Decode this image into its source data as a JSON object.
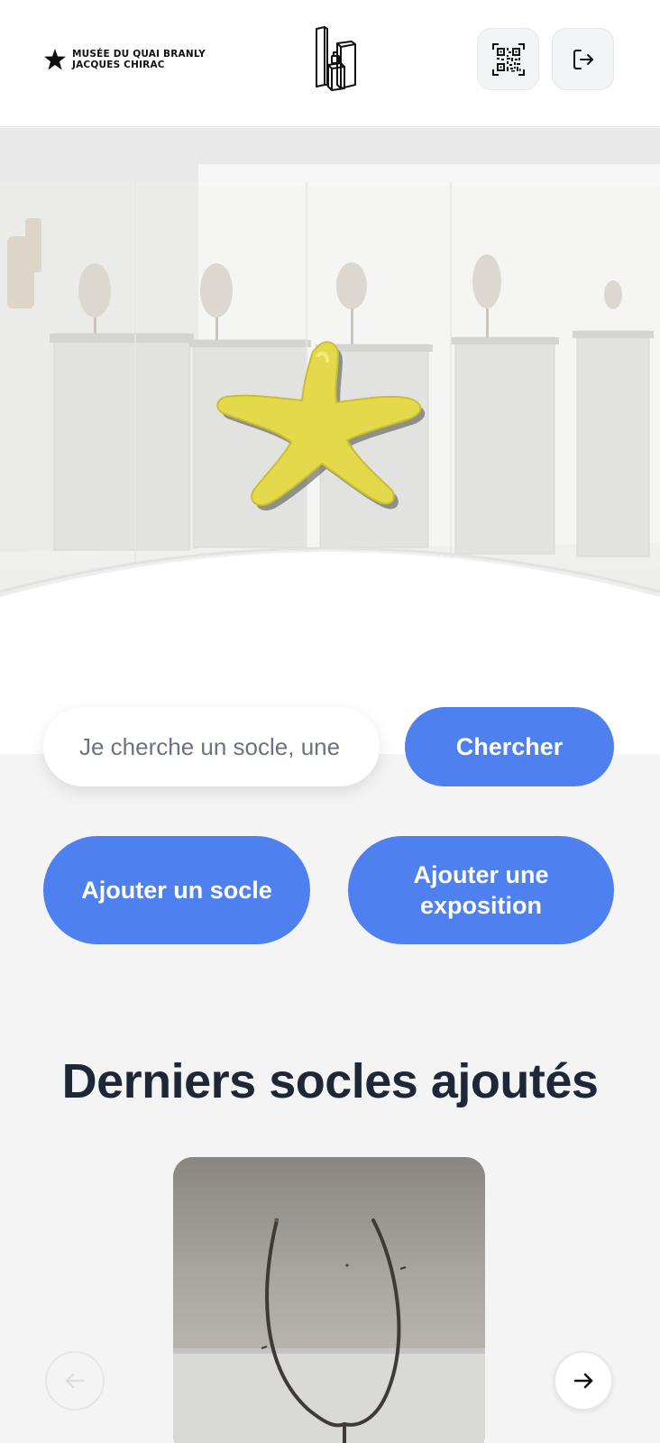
{
  "header": {
    "brand_line1": "MUSÉE DU QUAI BRANLY",
    "brand_line2": "JACQUES CHIRAC",
    "qr_icon": "qr-code-icon",
    "logout_icon": "logout-icon"
  },
  "hero": {
    "mascot_icon": "yellow-star-icon",
    "mascot_color": "#e3d94a"
  },
  "search": {
    "placeholder": "Je cherche un socle, une exposition...",
    "button_label": "Chercher"
  },
  "actions": {
    "add_socle_label": "Ajouter un socle",
    "add_exposition_label": "Ajouter une exposition"
  },
  "latest": {
    "title": "Derniers socles ajoutés",
    "prev_icon": "arrow-left-icon",
    "next_icon": "arrow-right-icon"
  },
  "colors": {
    "accent": "#4f80ef",
    "background": "#f4f4f5",
    "title": "#1e2738"
  }
}
